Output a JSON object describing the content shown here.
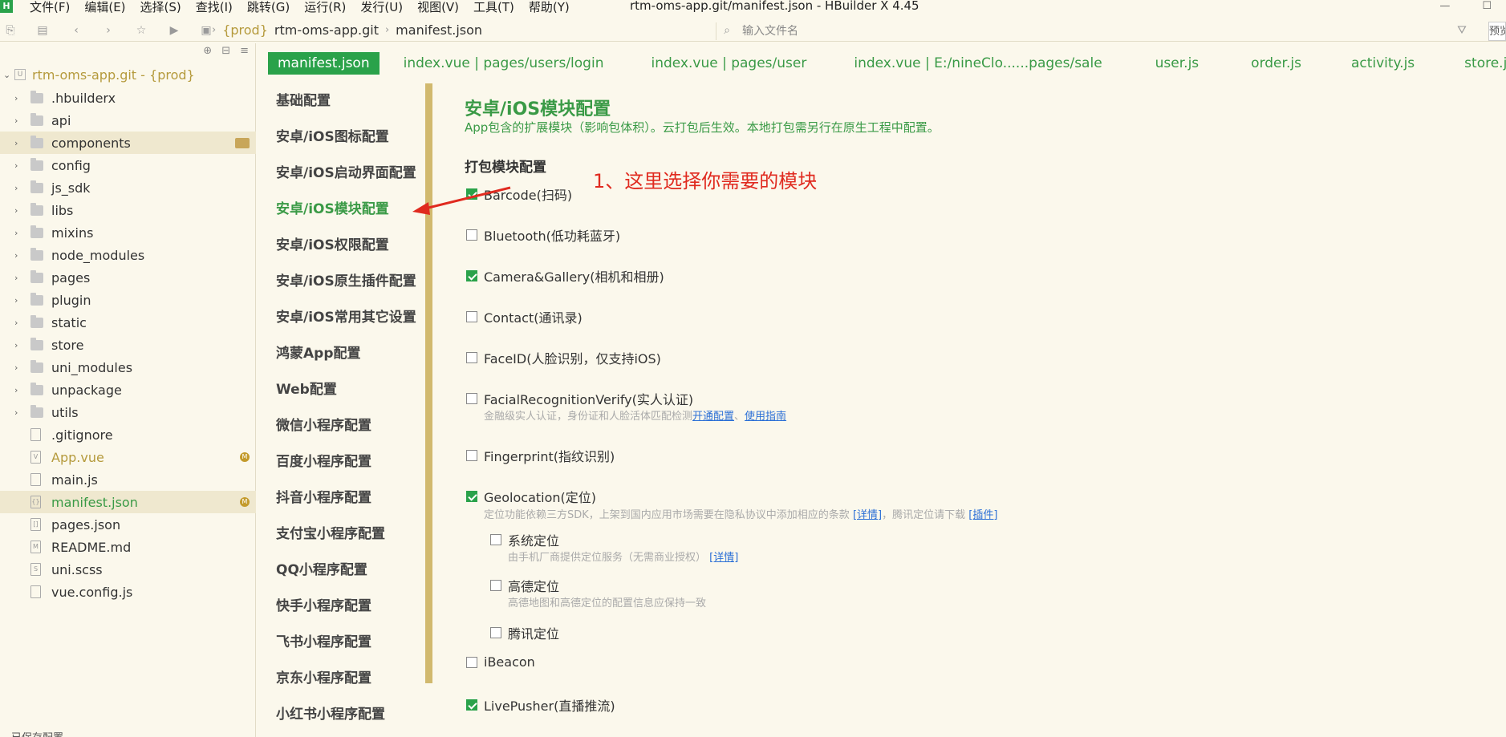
{
  "app": {
    "logo_letter": "H",
    "window_title": "rtm-oms-app.git/manifest.json - HBuilder X 4.45"
  },
  "menu": {
    "items": [
      "文件(F)",
      "编辑(E)",
      "选择(S)",
      "查找(I)",
      "跳转(G)",
      "运行(R)",
      "发行(U)",
      "视图(V)",
      "工具(T)",
      "帮助(Y)"
    ]
  },
  "toolbar": {
    "breadcrumb": {
      "prod": "{prod}",
      "project": "rtm-oms-app.git",
      "file": "manifest.json"
    },
    "search_placeholder": "输入文件名",
    "preview_label": "预览"
  },
  "sidebar": {
    "root_label": "rtm-oms-app.git - {prod}",
    "items": [
      {
        "label": ".hbuilderx",
        "type": "folder"
      },
      {
        "label": "api",
        "type": "folder"
      },
      {
        "label": "components",
        "type": "folder"
      },
      {
        "label": "config",
        "type": "folder"
      },
      {
        "label": "js_sdk",
        "type": "folder"
      },
      {
        "label": "libs",
        "type": "folder"
      },
      {
        "label": "mixins",
        "type": "folder"
      },
      {
        "label": "node_modules",
        "type": "folder"
      },
      {
        "label": "pages",
        "type": "folder"
      },
      {
        "label": "plugin",
        "type": "folder"
      },
      {
        "label": "static",
        "type": "folder"
      },
      {
        "label": "store",
        "type": "folder"
      },
      {
        "label": "uni_modules",
        "type": "folder"
      },
      {
        "label": "unpackage",
        "type": "folder"
      },
      {
        "label": "utils",
        "type": "folder"
      },
      {
        "label": ".gitignore",
        "type": "file"
      },
      {
        "label": "App.vue",
        "type": "file",
        "badge": "M"
      },
      {
        "label": "main.js",
        "type": "file"
      },
      {
        "label": "manifest.json",
        "type": "file",
        "badge": "M"
      },
      {
        "label": "pages.json",
        "type": "file"
      },
      {
        "label": "README.md",
        "type": "file"
      },
      {
        "label": "uni.scss",
        "type": "file"
      },
      {
        "label": "vue.config.js",
        "type": "file"
      }
    ],
    "bottom_cut_text": "已保存配置"
  },
  "tabs": [
    "manifest.json",
    "index.vue | pages/users/login",
    "index.vue | pages/user",
    "index.vue | E:/nineClo......pages/sale",
    "user.js",
    "order.js",
    "activity.js",
    "store.js"
  ],
  "settings_nav": [
    "基础配置",
    "安卓/iOS图标配置",
    "安卓/iOS启动界面配置",
    "安卓/iOS模块配置",
    "安卓/iOS权限配置",
    "安卓/iOS原生插件配置",
    "安卓/iOS常用其它设置",
    "鸿蒙App配置",
    "Web配置",
    "微信小程序配置",
    "百度小程序配置",
    "抖音小程序配置",
    "支付宝小程序配置",
    "QQ小程序配置",
    "快手小程序配置",
    "飞书小程序配置",
    "京东小程序配置",
    "小红书小程序配置"
  ],
  "content": {
    "title": "安卓/iOS模块配置",
    "subtitle": "App包含的扩展模块（影响包体积）。云打包后生效。本地打包需另行在原生工程中配置。",
    "section_title": "打包模块配置",
    "modules": [
      {
        "label": "Barcode(扫码)",
        "checked": true
      },
      {
        "label": "Bluetooth(低功耗蓝牙)",
        "checked": false
      },
      {
        "label": "Camera&Gallery(相机和相册)",
        "checked": true
      },
      {
        "label": "Contact(通讯录)",
        "checked": false
      },
      {
        "label": "FaceID(人脸识别，仅支持iOS)",
        "checked": false
      },
      {
        "label": "FacialRecognitionVerify(实人认证)",
        "checked": false
      },
      {
        "label": "Fingerprint(指纹识别)",
        "checked": false
      },
      {
        "label": "Geolocation(定位)",
        "checked": true
      },
      {
        "label": "iBeacon",
        "checked": false
      },
      {
        "label": "LivePusher(直播推流)",
        "checked": true
      }
    ],
    "facial_desc": {
      "text": "金融级实人认证，身份证和人脸活体匹配检测",
      "link1": "开通配置",
      "sep": "、",
      "link2": "使用指南"
    },
    "geo_desc": {
      "text": "定位功能依赖三方SDK，上架到国内应用市场需要在隐私协议中添加相应的条款",
      "link1": "[详情]",
      "mid": "，腾讯定位请下载",
      "link2": "[插件]"
    },
    "geo_sub": [
      {
        "label": "系统定位",
        "checked": false,
        "desc": "由手机厂商提供定位服务（无需商业授权）",
        "link": "[详情]"
      },
      {
        "label": "高德定位",
        "checked": false,
        "desc": "高德地图和高德定位的配置信息应保持一致"
      },
      {
        "label": "腾讯定位",
        "checked": false
      }
    ]
  },
  "annotation": {
    "text": "1、这里选择你需要的模块",
    "color": "#e02a1f"
  },
  "colors": {
    "accent": "#2aa24a",
    "background": "#fbf8ec",
    "scrollbar": "#d1b96e",
    "link": "#2b6fd6"
  }
}
